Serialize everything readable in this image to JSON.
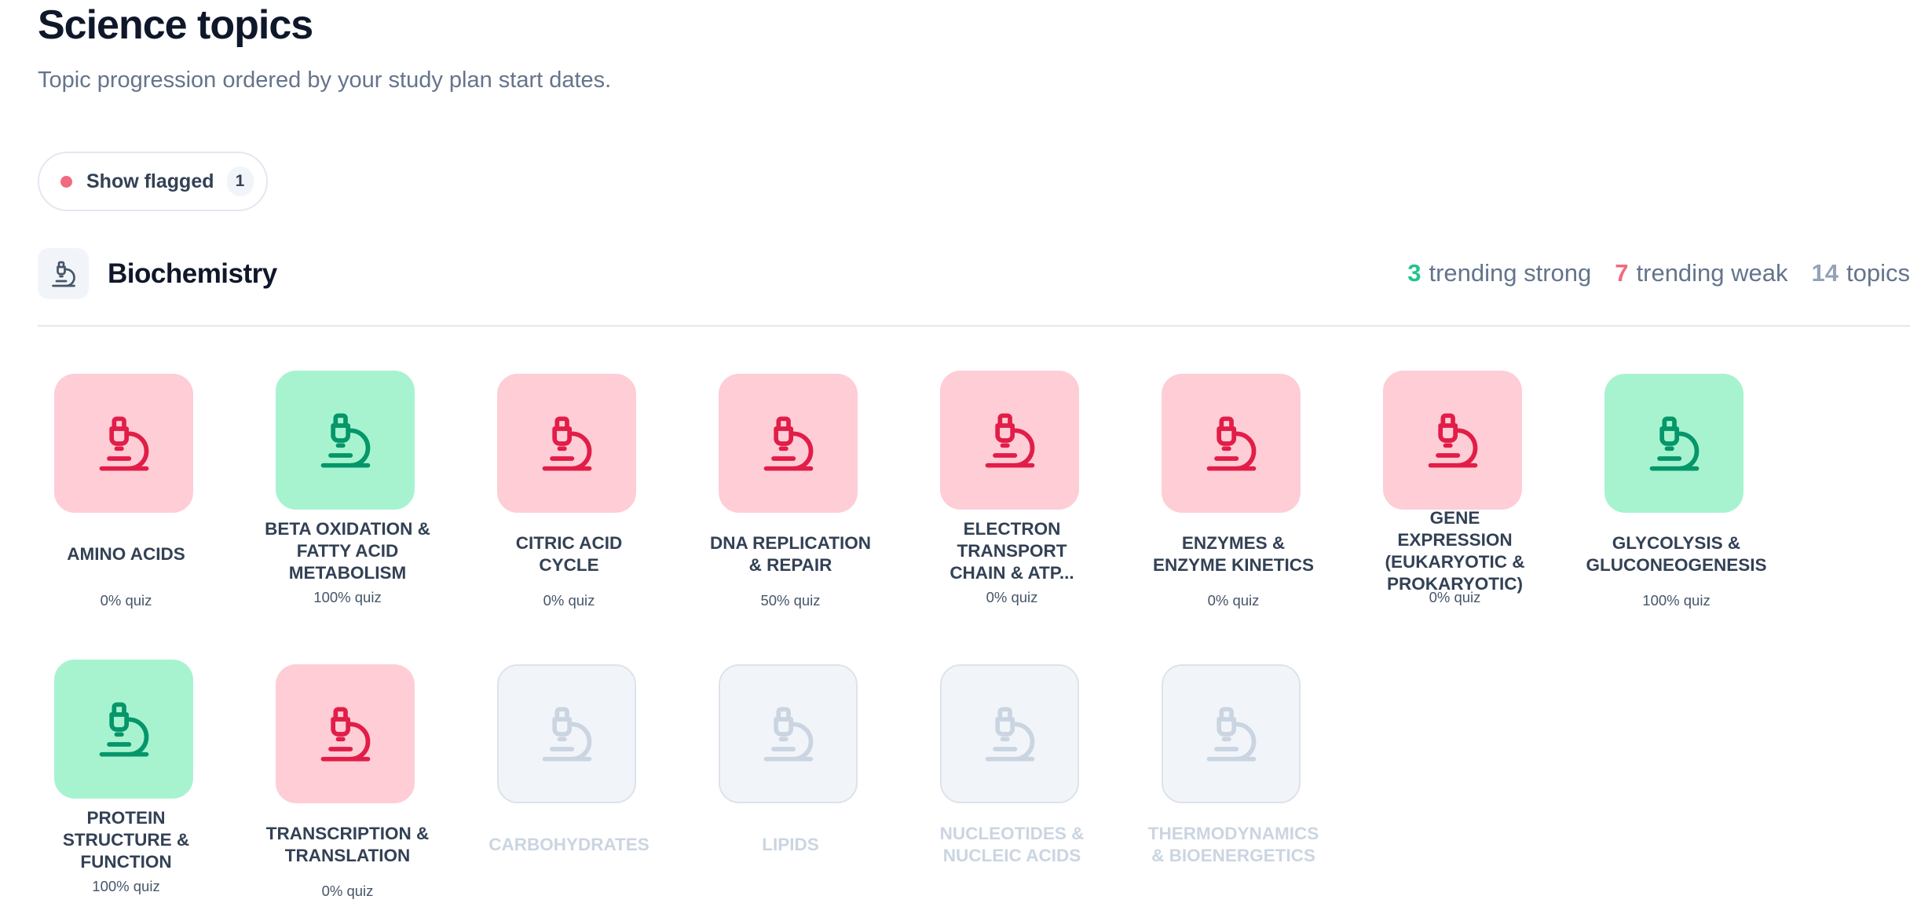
{
  "page": {
    "title": "Science topics",
    "subtitle": "Topic progression ordered by your study plan start dates."
  },
  "filter": {
    "label": "Show flagged",
    "count": "1"
  },
  "section": {
    "icon": "microscope-icon",
    "title": "Biochemistry",
    "stats": {
      "strong_count": "3",
      "strong_label": "trending strong",
      "weak_count": "7",
      "weak_label": "trending weak",
      "total_count": "14",
      "total_label": "topics"
    }
  },
  "colors": {
    "weak_bg": "#fecdd6",
    "weak_icon": "#e11d48",
    "strong_bg": "#a7f3d0",
    "strong_icon": "#059669",
    "inactive_bg": "#f1f5f9",
    "inactive_icon": "#cbd5e1"
  },
  "topics": [
    {
      "name": "AMINO ACIDS",
      "quiz": "0% quiz",
      "status": "weak"
    },
    {
      "name": "BETA OXIDATION & FATTY ACID METABOLISM",
      "quiz": "100% quiz",
      "status": "strong"
    },
    {
      "name": "CITRIC ACID CYCLE",
      "quiz": "0% quiz",
      "status": "weak"
    },
    {
      "name": "DNA REPLICATION & REPAIR",
      "quiz": "50% quiz",
      "status": "weak"
    },
    {
      "name": "ELECTRON TRANSPORT CHAIN & ATP...",
      "quiz": "0% quiz",
      "status": "weak"
    },
    {
      "name": "ENZYMES & ENZYME KINETICS",
      "quiz": "0% quiz",
      "status": "weak"
    },
    {
      "name": "GENE EXPRESSION (EUKARYOTIC & PROKARYOTIC)",
      "quiz": "0% quiz",
      "status": "weak"
    },
    {
      "name": "GLYCOLYSIS & GLUCONEOGENESIS",
      "quiz": "100% quiz",
      "status": "strong"
    },
    {
      "name": "PROTEIN STRUCTURE & FUNCTION",
      "quiz": "100% quiz",
      "status": "strong"
    },
    {
      "name": "TRANSCRIPTION & TRANSLATION",
      "quiz": "0% quiz",
      "status": "weak"
    },
    {
      "name": "CARBOHYDRATES",
      "quiz": "",
      "status": "none"
    },
    {
      "name": "LIPIDS",
      "quiz": "",
      "status": "none"
    },
    {
      "name": "NUCLEOTIDES & NUCLEIC ACIDS",
      "quiz": "",
      "status": "none"
    },
    {
      "name": "THERMODYNAMICS & BIOENERGETICS",
      "quiz": "",
      "status": "none"
    }
  ]
}
